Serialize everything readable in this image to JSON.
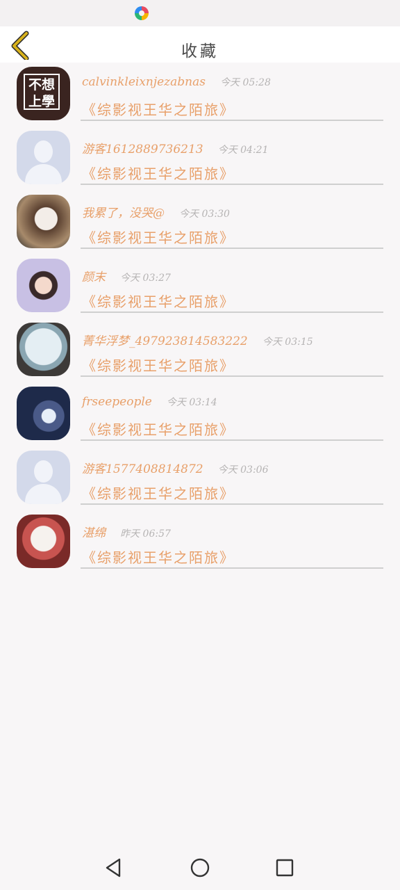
{
  "header": {
    "title": "收藏",
    "back_icon": "chevron-left-icon"
  },
  "favorites": [
    {
      "username": "calvinkleixnjezabnas",
      "time": "今天 05:28",
      "book": "《综影视王华之陌旅》",
      "avatar": "avatar-image"
    },
    {
      "username": "游客1612889736213",
      "time": "今天 04:21",
      "book": "《综影视王华之陌旅》",
      "avatar": "default-avatar"
    },
    {
      "username": "我累了，没哭@",
      "time": "今天 03:30",
      "book": "《综影视王华之陌旅》",
      "avatar": "avatar-image"
    },
    {
      "username": "颜末",
      "time": "今天 03:27",
      "book": "《综影视王华之陌旅》",
      "avatar": "avatar-image"
    },
    {
      "username": "菁华浮梦_497923814583222",
      "time": "今天 03:15",
      "book": "《综影视王华之陌旅》",
      "avatar": "avatar-image"
    },
    {
      "username": "frseepeople",
      "time": "今天 03:14",
      "book": "《综影视王华之陌旅》",
      "avatar": "avatar-image"
    },
    {
      "username": "游客1577408814872",
      "time": "今天 03:06",
      "book": "《综影视王华之陌旅》",
      "avatar": "default-avatar"
    },
    {
      "username": "湛绵",
      "time": "昨天 06:57",
      "book": "《综影视王华之陌旅》",
      "avatar": "avatar-image"
    }
  ],
  "avatar_sign_text": "不想上學",
  "colors": {
    "accent": "#e8a06a",
    "back_icon": "#d8b21c",
    "timestamp": "#b5b3b3"
  },
  "navbar": {
    "back": "back-triangle-icon",
    "home": "home-circle-icon",
    "recents": "recents-square-icon"
  }
}
